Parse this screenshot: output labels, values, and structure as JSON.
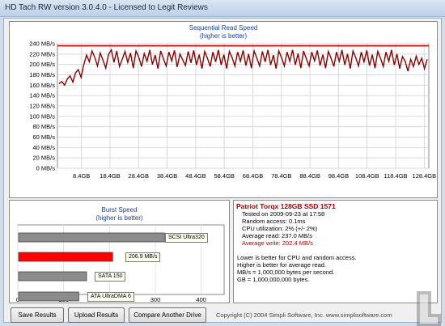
{
  "window": {
    "title": "HD Tach RW version 3.0.4.0 - Licensed to Legit Reviews"
  },
  "sequential": {
    "title": "Sequential Read Speed",
    "subtitle": "(higher is better)"
  },
  "burst": {
    "title": "Burst Speed",
    "subtitle": "(higher is better)",
    "bar_labels": [
      "SCSI Ultra320",
      "206.9 MB/s",
      "SATA 150",
      "ATA UltraDMA 6"
    ]
  },
  "info": {
    "drive": "Patriot Torqx 128GB SSD 1571",
    "tested": "Tested on 2009-09-23 at 17:58",
    "random_access": "Random access: 0.1ms",
    "cpu": "CPU utilization: 2% (+/- 2%)",
    "avg_read": "Average read: 237.0 MB/s",
    "avg_write": "Average write: 202.4 MB/s",
    "notes": [
      "Lower is better for CPU and random access.",
      "Higher is better for average read.",
      "MB/s = 1,000,000 bytes per second.",
      "GB = 1,000,000,000 bytes."
    ]
  },
  "buttons": {
    "save": "Save Results",
    "upload": "Upload Results",
    "compare": "Compare Another Drive"
  },
  "footer": {
    "copyright": "Copyright (C) 2004 Simpli Software, Inc. www.simplisoftware.com"
  },
  "colors": {
    "read": "#8b0000",
    "write_line": "#d40000",
    "burst_highlight": "#ff0000",
    "bar_gray": "#8c8c8c"
  },
  "chart_data": [
    {
      "type": "line",
      "title": "Sequential Read Speed",
      "subtitle": "(higher is better)",
      "ylabel": "",
      "xlabel": "",
      "ylim": [
        0,
        240
      ],
      "y_ticks": [
        "240 MB/s",
        "220 MB/s",
        "200 MB/s",
        "180 MB/s",
        "160 MB/s",
        "140 MB/s",
        "120 MB/s",
        "100 MB/s",
        "80 MB/s",
        "60 MB/s",
        "40 MB/s",
        "20 MB/s",
        "0 MB/s"
      ],
      "x_ticks": [
        "8.4GB",
        "18.4GB",
        "28.4GB",
        "38.4GB",
        "48.4GB",
        "58.4GB",
        "68.4GB",
        "78.4GB",
        "88.4GB",
        "98.4GB",
        "108.4GB",
        "118.4GB",
        "128.4GB"
      ],
      "xlim_gb": [
        0,
        130
      ],
      "write_constant_mbs": 236,
      "grid": true,
      "series": [
        {
          "values": [
            163,
            167,
            160,
            172,
            178,
            166,
            184,
            190,
            175,
            200,
            218,
            205,
            226,
            214,
            197,
            222,
            208,
            193,
            219,
            228,
            204,
            226,
            196,
            210,
            225,
            204,
            222,
            193,
            226,
            214,
            196,
            221,
            206,
            228,
            200,
            218,
            192,
            226,
            211,
            197,
            224,
            207,
            227,
            195,
            220,
            209,
            198,
            225,
            203,
            227,
            199,
            219,
            192,
            225,
            212,
            196,
            224,
            205,
            228,
            199,
            219,
            192,
            225,
            213,
            197,
            224,
            206,
            227,
            198,
            220,
            193,
            226,
            212,
            197,
            225,
            205,
            228,
            199,
            218,
            192,
            226,
            213,
            197,
            224,
            206,
            228,
            199,
            221,
            193,
            226,
            211,
            197,
            224,
            207,
            227,
            198,
            219,
            193,
            225,
            212,
            196,
            224,
            206,
            228,
            199,
            220,
            192,
            226,
            213,
            197,
            224,
            205,
            227,
            198,
            219,
            193,
            225,
            212,
            196,
            224,
            206,
            228,
            199,
            220,
            192,
            215,
            206,
            187,
            210,
            196,
            216,
            200,
            212,
            192,
            210
          ]
        }
      ]
    },
    {
      "type": "bar",
      "title": "Burst Speed",
      "subtitle": "(higher is better)",
      "categories": [
        "SCSI Ultra320",
        "206.9 MB/s",
        "SATA 150",
        "ATA UltraDMA 6"
      ],
      "values": [
        320,
        206.9,
        150,
        133
      ],
      "x_ticks": [
        "0",
        "100",
        "200",
        "300",
        "400"
      ],
      "xlim": [
        0,
        450
      ]
    }
  ]
}
